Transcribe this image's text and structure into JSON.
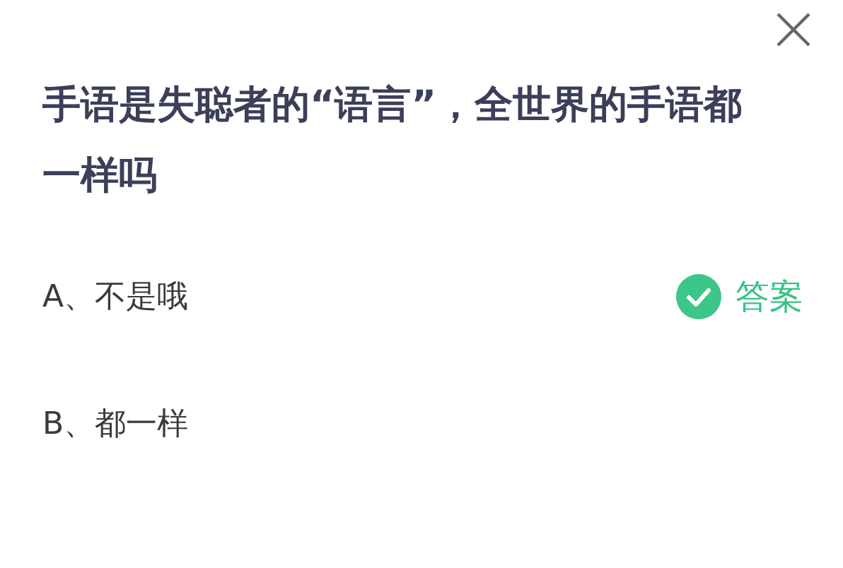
{
  "question": "手语是失聪者的“语言”，全世界的手语都一样吗",
  "options": [
    {
      "label": "A、不是哦",
      "correct": true
    },
    {
      "label": "B、都一样",
      "correct": false
    }
  ],
  "answer_badge": {
    "label": "答案"
  }
}
